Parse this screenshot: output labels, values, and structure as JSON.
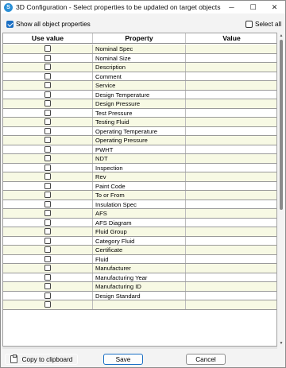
{
  "window": {
    "title": "3D Configuration - Select properties to be updated on target objects",
    "minimize": "─",
    "maximize": "☐",
    "close": "✕"
  },
  "options": {
    "show_all_label": "Show all object properties",
    "show_all_checked": true,
    "select_all_label": "Select all",
    "select_all_checked": false
  },
  "grid": {
    "columns": [
      "Use value",
      "Property",
      "Value"
    ],
    "rows": [
      {
        "property": "Nominal Spec"
      },
      {
        "property": "Nominal Size"
      },
      {
        "property": "Description"
      },
      {
        "property": "Comment"
      },
      {
        "property": "Service"
      },
      {
        "property": "Design Temperature"
      },
      {
        "property": "Design Pressure"
      },
      {
        "property": "Test Pressure"
      },
      {
        "property": "Testing Fluid"
      },
      {
        "property": "Operating Temperature"
      },
      {
        "property": "Operating Pressure"
      },
      {
        "property": "PWHT"
      },
      {
        "property": "NDT"
      },
      {
        "property": "Inspection"
      },
      {
        "property": "Rev"
      },
      {
        "property": "Paint Code"
      },
      {
        "property": "To or From"
      },
      {
        "property": "Insulation Spec"
      },
      {
        "property": "AFS"
      },
      {
        "property": "AFS Diagram"
      },
      {
        "property": "Fluid Group"
      },
      {
        "property": "Category Fluid"
      },
      {
        "property": "Certificate"
      },
      {
        "property": "Fluid"
      },
      {
        "property": "Manufacturer"
      },
      {
        "property": "Manufacturing Year"
      },
      {
        "property": "Manufacturing ID"
      },
      {
        "property": "Design Standard"
      },
      {
        "property": ""
      }
    ]
  },
  "footer": {
    "copy_label": "Copy to clipboard",
    "save_label": "Save",
    "cancel_label": "Cancel"
  },
  "colors": {
    "accent": "#1a6fc4",
    "row_alt": "#f7f9e4"
  }
}
